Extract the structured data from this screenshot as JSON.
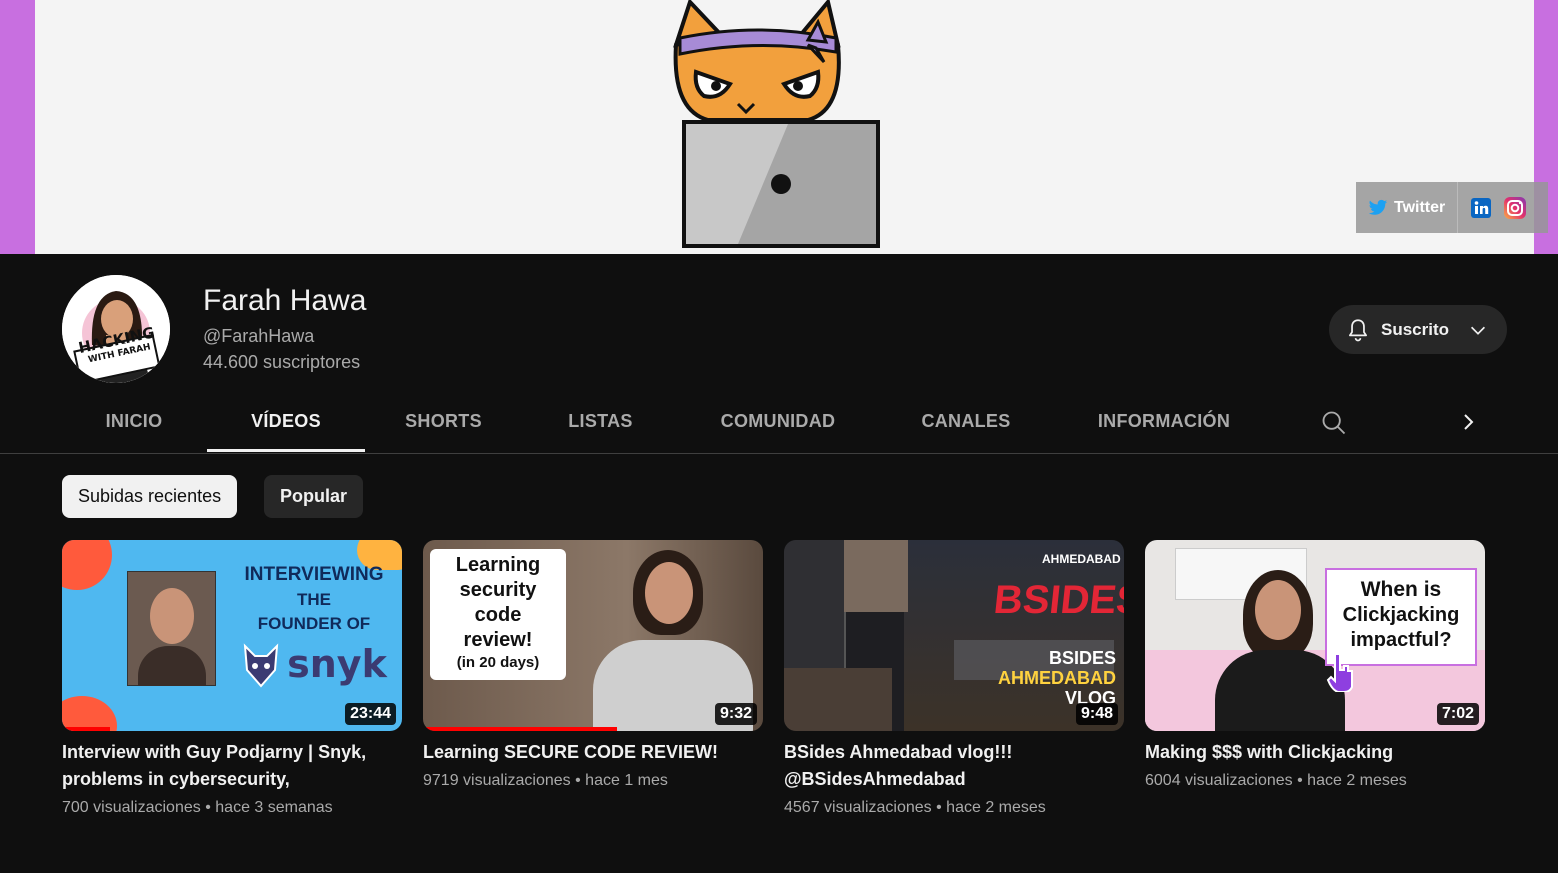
{
  "banner": {
    "social": {
      "twitter_label": "Twitter",
      "linkedin_icon": "linkedin-icon",
      "instagram_icon": "instagram-icon"
    },
    "colors": {
      "border": "#c86fe0",
      "background": "#f4f4f4"
    }
  },
  "channel": {
    "name": "Farah Hawa",
    "handle": "@FarahHawa",
    "subscribers": "44.600 suscriptores",
    "avatar_text_1": "HACKING",
    "avatar_text_2": "WITH FARAH",
    "subscribe_label": "Suscrito"
  },
  "tabs": [
    {
      "label": "INICIO"
    },
    {
      "label": "VÍDEOS",
      "active": true
    },
    {
      "label": "SHORTS"
    },
    {
      "label": "LISTAS"
    },
    {
      "label": "COMUNIDAD"
    },
    {
      "label": "CANALES"
    },
    {
      "label": "INFORMACIÓN"
    }
  ],
  "chips": {
    "recent": "Subidas recientes",
    "popular": "Popular"
  },
  "videos": [
    {
      "title": "Interview with Guy Podjarny | Snyk, problems in cybersecurity,",
      "views": "700 visualizaciones",
      "age": "hace 3 semanas",
      "duration": "23:44",
      "thumb_text": [
        "INTERVIEWING",
        "THE",
        "FOUNDER OF",
        "snyk"
      ],
      "watched_fraction": 0.14
    },
    {
      "title": "Learning SECURE CODE REVIEW!",
      "views": "9719 visualizaciones",
      "age": "hace 1 mes",
      "duration": "9:32",
      "thumb_text": [
        "Learning",
        "security",
        "code",
        "review!",
        "(in 20 days)"
      ],
      "watched_fraction": 0.57
    },
    {
      "title": "BSides Ahmedabad vlog!!! @BSidesAhmedabad",
      "views": "4567 visualizaciones",
      "age": "hace 2 meses",
      "duration": "9:48",
      "thumb_text": [
        "BSIDES",
        "AHMEDABAD",
        "VLOG",
        "AHMEDABAD",
        "BSIDES"
      ],
      "watched_fraction": 0
    },
    {
      "title": "Making $$$ with Clickjacking",
      "views": "6004 visualizaciones",
      "age": "hace 2 meses",
      "duration": "7:02",
      "thumb_text": [
        "When is",
        "Clickjacking",
        "impactful?"
      ],
      "watched_fraction": 0
    }
  ],
  "meta_separator": "•"
}
